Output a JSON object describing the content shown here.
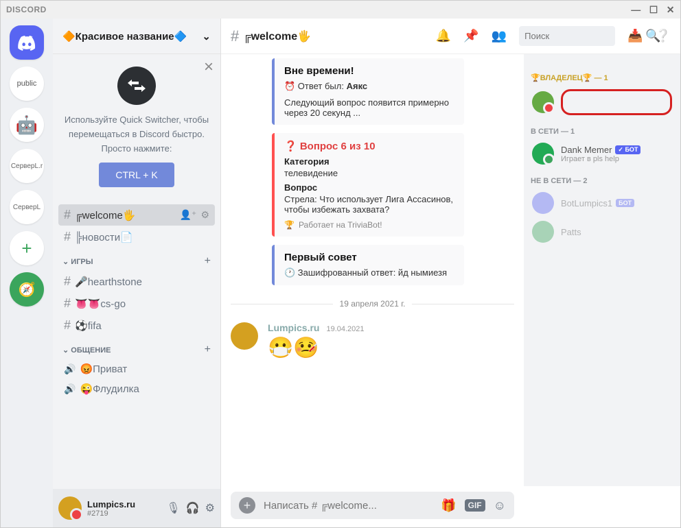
{
  "titlebar": {
    "brand": "DISCORD"
  },
  "guilds": {
    "public": "public",
    "s1": "СерверL.r",
    "s2": "СерверL"
  },
  "server": {
    "name": "🔶Красивое название🔷"
  },
  "qs": {
    "line": "Используйте Quick Switcher, чтобы перемещаться в Discord быстро. Просто нажмите:",
    "btn": "CTRL + K"
  },
  "channels": {
    "welcome": "╔welcome🖐️",
    "news": "╠новости📄",
    "cat_games": "ИГРЫ",
    "hs": "🎤hearthstone",
    "csgo": "👅👅cs-go",
    "fifa": "⚽fifa",
    "cat_chat": "ОБЩЕНИЕ",
    "privat": "😡Приват",
    "flood": "😜Флудилка"
  },
  "user": {
    "name": "Lumpics.ru",
    "tag": "#2719"
  },
  "header": {
    "channel": "╔welcome🖐️",
    "search_ph": "Поиск"
  },
  "chat": {
    "e1_title": "Вне времени!",
    "e1_answer_lbl": "⏰ Ответ был:",
    "e1_answer": "Аякс",
    "e1_next": "Следующий вопрос появится примерно через 20 секунд ...",
    "e2_title": "❓ Вопрос 6 из 10",
    "e2_cat_lbl": "Категория",
    "e2_cat": "телевидение",
    "e2_q_lbl": "Вопрос",
    "e2_q": "Стрела: Что использует Лига Ассасинов, чтобы избежать захвата?",
    "e2_foot": "Работает на TriviaBot!",
    "e3_title": "Первый совет",
    "e3_body": "🕐 Зашифрованный ответ: йд нымиезя",
    "divider": "19 апреля 2021 г.",
    "msg_author": "Lumpics.ru",
    "msg_date": "19.04.2021",
    "input_ph": "Написать # ╔welcome..."
  },
  "members": {
    "owner_hdr": "🏆ВЛАДЕЛЕЦ🏆 — 1",
    "online_hdr": "В СЕТИ — 1",
    "dank": "Dank Memer",
    "dank_status": "Играет в pls help",
    "bot": "✓ БОТ",
    "bot2": "БОТ",
    "offline_hdr": "НЕ В СЕТИ — 2",
    "bl": "BotLumpics1",
    "patts": "Patts"
  }
}
